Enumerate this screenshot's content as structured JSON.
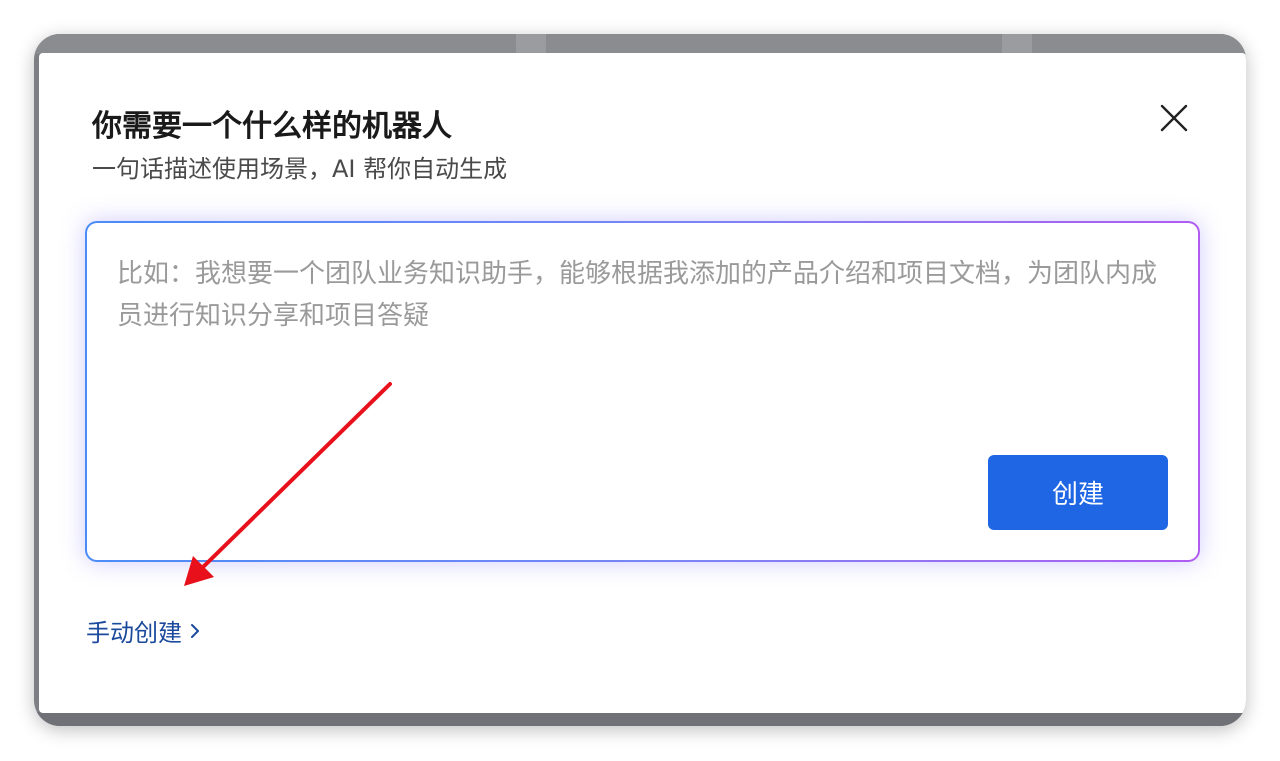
{
  "dialog": {
    "title": "你需要一个什么样的机器人",
    "subtitle": "一句话描述使用场景，AI 帮你自动生成",
    "close_icon": "close-icon"
  },
  "prompt": {
    "value": "",
    "placeholder": "比如：我想要一个团队业务知识助手，能够根据我添加的产品介绍和项目文档，为团队内成员进行知识分享和项目答疑",
    "border_colors": [
      "#4a8cf7",
      "#7d84f5",
      "#b05cf0"
    ]
  },
  "actions": {
    "create_label": "创建",
    "create_color": "#1f66e5",
    "manual_label": "手动创建",
    "manual_icon": "chevron-right-icon",
    "manual_color": "#1b4a9c"
  },
  "annotation": {
    "arrow_icon": "red-arrow-icon",
    "arrow_color": "#e8101a"
  }
}
